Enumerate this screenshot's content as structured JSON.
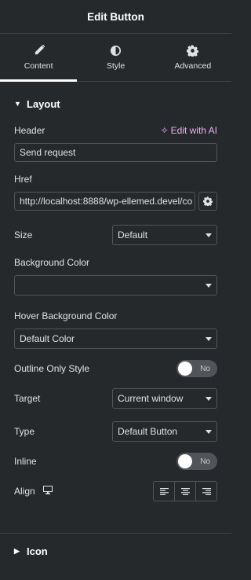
{
  "header": {
    "title": "Edit Button"
  },
  "tabs": [
    {
      "label": "Content",
      "icon": "pencil-icon",
      "active": true
    },
    {
      "label": "Style",
      "icon": "half-circle-icon",
      "active": false
    },
    {
      "label": "Advanced",
      "icon": "gear-icon",
      "active": false
    }
  ],
  "layout": {
    "title": "Layout",
    "header_label": "Header",
    "edit_ai": "Edit with AI",
    "header_value": "Send request",
    "href_label": "Href",
    "href_value": "http://localhost:8888/wp-ellemed.devel/co",
    "size_label": "Size",
    "size_value": "Default",
    "bg_color_label": "Background Color",
    "bg_color_value": "",
    "hover_bg_label": "Hover Background Color",
    "hover_bg_value": "Default Color",
    "outline_label": "Outline Only Style",
    "outline_toggle": "No",
    "target_label": "Target",
    "target_value": "Current window",
    "type_label": "Type",
    "type_value": "Default Button",
    "inline_label": "Inline",
    "inline_toggle": "No",
    "align_label": "Align"
  },
  "icon_section": {
    "title": "Icon"
  },
  "colors": {
    "background": "#26292c",
    "accent_ai": "#f0abfc",
    "border": "#525458"
  }
}
